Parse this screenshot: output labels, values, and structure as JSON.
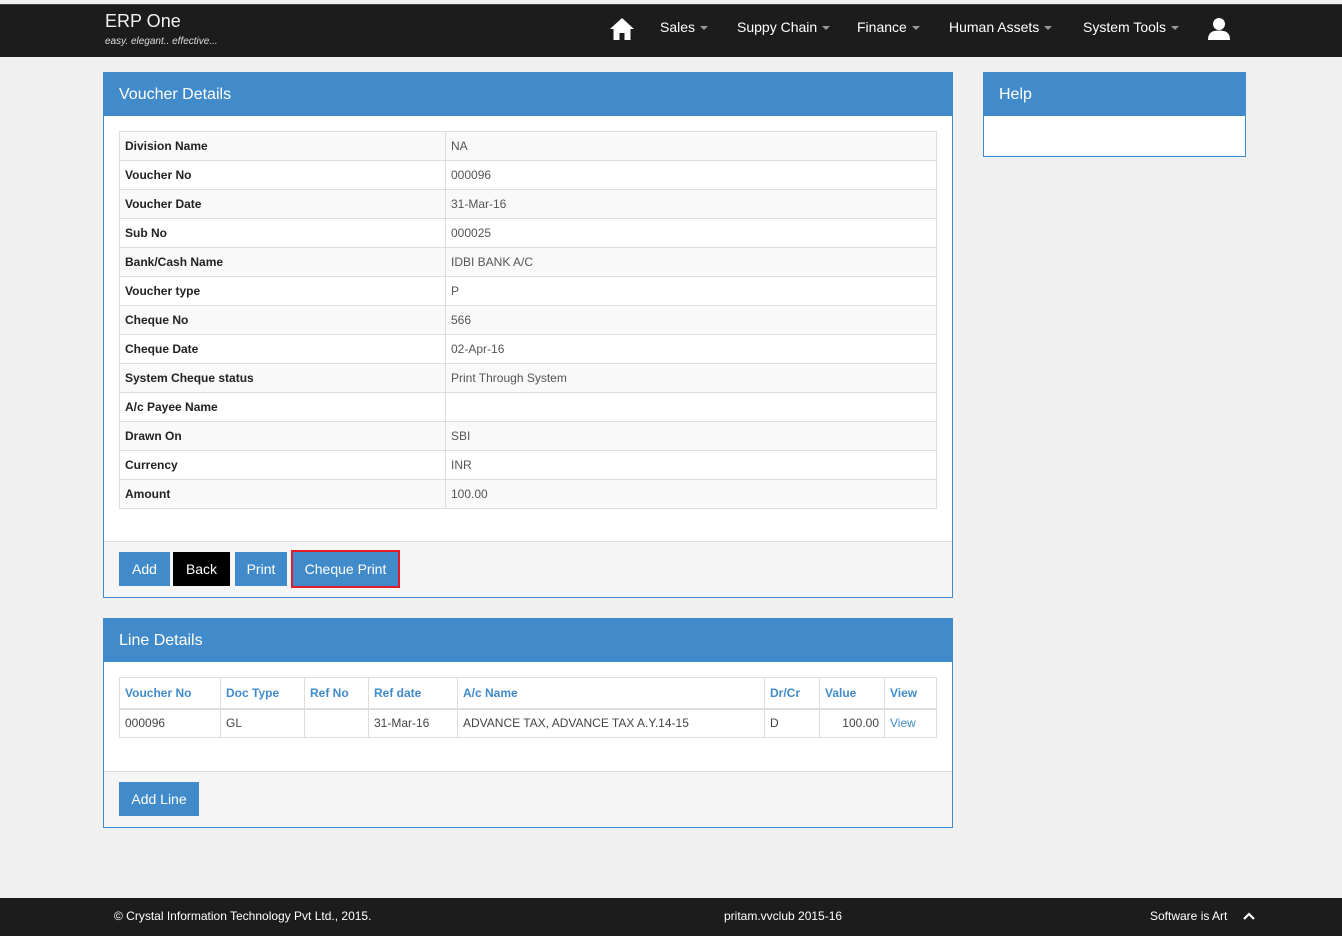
{
  "app": {
    "title": "ERP One",
    "tagline": "easy. elegant.. effective..."
  },
  "nav": {
    "items": [
      {
        "label": "Sales"
      },
      {
        "label": "Suppy Chain"
      },
      {
        "label": "Finance"
      },
      {
        "label": "Human Assets"
      },
      {
        "label": "System Tools"
      }
    ]
  },
  "voucher": {
    "heading": "Voucher Details",
    "rows": [
      {
        "label": "Division Name",
        "value": "NA"
      },
      {
        "label": "Voucher No",
        "value": "000096"
      },
      {
        "label": "Voucher Date",
        "value": "31-Mar-16"
      },
      {
        "label": "Sub No",
        "value": "000025"
      },
      {
        "label": "Bank/Cash Name",
        "value": "IDBI BANK A/C"
      },
      {
        "label": "Voucher type",
        "value": "P"
      },
      {
        "label": "Cheque No",
        "value": "566"
      },
      {
        "label": "Cheque Date",
        "value": "02-Apr-16"
      },
      {
        "label": "System Cheque status",
        "value": "Print Through System"
      },
      {
        "label": "A/c Payee Name",
        "value": ""
      },
      {
        "label": "Drawn On",
        "value": "SBI"
      },
      {
        "label": "Currency",
        "value": "INR"
      },
      {
        "label": "Amount",
        "value": "100.00"
      }
    ],
    "buttons": {
      "add": "Add",
      "back": "Back",
      "print": "Print",
      "cheque_print": "Cheque Print"
    }
  },
  "help": {
    "heading": "Help"
  },
  "lines": {
    "heading": "Line Details",
    "columns": [
      "Voucher No",
      "Doc Type",
      "Ref No",
      "Ref date",
      "A/c Name",
      "Dr/Cr",
      "Value",
      "View"
    ],
    "rows": [
      {
        "voucher_no": "000096",
        "doc_type": "GL",
        "ref_no": "",
        "ref_date": "31-Mar-16",
        "ac_name": "ADVANCE TAX, ADVANCE TAX A.Y.14-15",
        "dr_cr": "D",
        "value": "100.00",
        "view": "View"
      }
    ],
    "add_line": "Add Line"
  },
  "footer": {
    "copyright": "© Crystal Information Technology Pvt Ltd., 2015.",
    "session": "pritam.vvclub 2015-16",
    "slogan": "Software is Art"
  },
  "icons": {
    "home": "home-icon",
    "user": "user-icon",
    "back_to_top": "chevron-up-icon"
  },
  "colors": {
    "primary": "#428bca",
    "navbar": "#1c1c1c",
    "highlight": "#e21d2a"
  }
}
